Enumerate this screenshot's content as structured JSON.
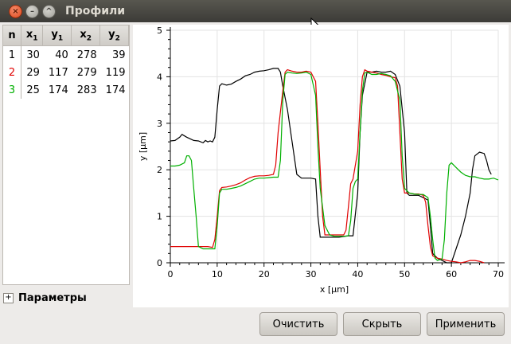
{
  "window": {
    "title": "Профили"
  },
  "table": {
    "headers": [
      {
        "main": "n",
        "sub": ""
      },
      {
        "main": "x",
        "sub": "1"
      },
      {
        "main": "y",
        "sub": "1"
      },
      {
        "main": "x",
        "sub": "2"
      },
      {
        "main": "y",
        "sub": "2"
      }
    ],
    "rows": [
      {
        "n": "1",
        "x1": "30",
        "y1": "40",
        "x2": "278",
        "y2": "39",
        "color": "#000000"
      },
      {
        "n": "2",
        "x1": "29",
        "y1": "117",
        "x2": "279",
        "y2": "119",
        "color": "#e00000"
      },
      {
        "n": "3",
        "x1": "25",
        "y1": "174",
        "x2": "283",
        "y2": "174",
        "color": "#00b000"
      }
    ]
  },
  "params": {
    "label": "Параметры",
    "expand_icon": "+"
  },
  "buttons": {
    "clear": "Очистить",
    "hide": "Скрыть",
    "apply": "Применить"
  },
  "chart_data": {
    "type": "line",
    "xlabel": "x [µm]",
    "ylabel": "y [µm]",
    "xlim": [
      0,
      70
    ],
    "ylim": [
      0,
      5
    ],
    "xticks": [
      0,
      10,
      20,
      30,
      40,
      50,
      60,
      70
    ],
    "yticks": [
      0,
      1,
      2,
      3,
      4,
      5
    ],
    "grid": true,
    "series": [
      {
        "color": "#000000",
        "points": [
          [
            0,
            2.62
          ],
          [
            1,
            2.63
          ],
          [
            2,
            2.7
          ],
          [
            2.5,
            2.76
          ],
          [
            3.5,
            2.7
          ],
          [
            5,
            2.63
          ],
          [
            6,
            2.62
          ],
          [
            7,
            2.58
          ],
          [
            7.5,
            2.63
          ],
          [
            8,
            2.6
          ],
          [
            8.5,
            2.62
          ],
          [
            9,
            2.6
          ],
          [
            9.5,
            2.7
          ],
          [
            10,
            3.3
          ],
          [
            10.5,
            3.8
          ],
          [
            11,
            3.85
          ],
          [
            12,
            3.82
          ],
          [
            13,
            3.84
          ],
          [
            14,
            3.9
          ],
          [
            15,
            3.95
          ],
          [
            16,
            4.02
          ],
          [
            17,
            4.05
          ],
          [
            18,
            4.1
          ],
          [
            19,
            4.12
          ],
          [
            20,
            4.13
          ],
          [
            21,
            4.15
          ],
          [
            22,
            4.18
          ],
          [
            23,
            4.18
          ],
          [
            23.5,
            4.1
          ],
          [
            24,
            3.8
          ],
          [
            25,
            3.3
          ],
          [
            26,
            2.6
          ],
          [
            27,
            1.9
          ],
          [
            28,
            1.82
          ],
          [
            29,
            1.82
          ],
          [
            30,
            1.82
          ],
          [
            31,
            1.8
          ],
          [
            31.5,
            1.0
          ],
          [
            32,
            0.55
          ],
          [
            33,
            0.55
          ],
          [
            34,
            0.55
          ],
          [
            36,
            0.55
          ],
          [
            38,
            0.58
          ],
          [
            39,
            0.58
          ],
          [
            40,
            1.5
          ],
          [
            40.5,
            2.8
          ],
          [
            41,
            3.6
          ],
          [
            42,
            4.1
          ],
          [
            43,
            4.1
          ],
          [
            44,
            4.12
          ],
          [
            45,
            4.1
          ],
          [
            46,
            4.1
          ],
          [
            47,
            4.12
          ],
          [
            48,
            4.05
          ],
          [
            49,
            3.8
          ],
          [
            50,
            2.8
          ],
          [
            50.5,
            1.5
          ],
          [
            51,
            1.45
          ],
          [
            52,
            1.45
          ],
          [
            53,
            1.45
          ],
          [
            54,
            1.4
          ],
          [
            55,
            1.35
          ],
          [
            55.5,
            0.8
          ],
          [
            56,
            0.2
          ],
          [
            57,
            0.1
          ],
          [
            58,
            0.05
          ],
          [
            59,
            0.0
          ],
          [
            60,
            0.0
          ],
          [
            61,
            0.3
          ],
          [
            62,
            0.6
          ],
          [
            63,
            1.0
          ],
          [
            64,
            1.5
          ],
          [
            64.5,
            2.0
          ],
          [
            65,
            2.3
          ],
          [
            66,
            2.38
          ],
          [
            67,
            2.35
          ],
          [
            67.5,
            2.2
          ],
          [
            68,
            2.0
          ],
          [
            68.5,
            1.9
          ]
        ]
      },
      {
        "color": "#e00000",
        "points": [
          [
            0,
            0.35
          ],
          [
            2,
            0.35
          ],
          [
            4,
            0.35
          ],
          [
            6,
            0.35
          ],
          [
            8,
            0.35
          ],
          [
            9,
            0.33
          ],
          [
            9.5,
            0.5
          ],
          [
            10,
            1.0
          ],
          [
            10.5,
            1.55
          ],
          [
            11,
            1.62
          ],
          [
            12,
            1.63
          ],
          [
            13,
            1.65
          ],
          [
            14,
            1.68
          ],
          [
            15,
            1.72
          ],
          [
            16,
            1.78
          ],
          [
            17,
            1.83
          ],
          [
            18,
            1.86
          ],
          [
            19,
            1.87
          ],
          [
            20,
            1.87
          ],
          [
            21,
            1.88
          ],
          [
            22,
            1.9
          ],
          [
            22.5,
            2.1
          ],
          [
            23,
            2.8
          ],
          [
            24,
            3.7
          ],
          [
            24.5,
            4.1
          ],
          [
            25,
            4.15
          ],
          [
            26,
            4.12
          ],
          [
            27,
            4.1
          ],
          [
            28,
            4.1
          ],
          [
            29,
            4.12
          ],
          [
            30,
            4.1
          ],
          [
            31,
            3.9
          ],
          [
            31.5,
            3.0
          ],
          [
            32,
            2.0
          ],
          [
            32.5,
            1.0
          ],
          [
            33,
            0.6
          ],
          [
            34,
            0.6
          ],
          [
            35,
            0.6
          ],
          [
            36,
            0.6
          ],
          [
            37,
            0.6
          ],
          [
            37.5,
            0.7
          ],
          [
            38,
            1.2
          ],
          [
            38.5,
            1.7
          ],
          [
            39,
            1.8
          ],
          [
            40,
            2.4
          ],
          [
            40.5,
            3.4
          ],
          [
            41,
            4.0
          ],
          [
            41.5,
            4.15
          ],
          [
            42,
            4.12
          ],
          [
            43,
            4.1
          ],
          [
            44,
            4.08
          ],
          [
            45,
            4.05
          ],
          [
            46,
            4.03
          ],
          [
            47,
            4.0
          ],
          [
            48,
            3.98
          ],
          [
            48.5,
            3.8
          ],
          [
            49,
            2.8
          ],
          [
            49.5,
            1.8
          ],
          [
            50,
            1.5
          ],
          [
            51,
            1.5
          ],
          [
            52,
            1.48
          ],
          [
            53,
            1.48
          ],
          [
            54,
            1.45
          ],
          [
            54.5,
            1.3
          ],
          [
            55,
            0.8
          ],
          [
            55.5,
            0.35
          ],
          [
            56,
            0.15
          ],
          [
            57,
            0.1
          ],
          [
            58,
            0.08
          ],
          [
            59,
            0.05
          ],
          [
            60,
            0.03
          ],
          [
            61,
            0.02
          ],
          [
            62,
            0.0
          ],
          [
            63,
            0.02
          ],
          [
            64,
            0.05
          ],
          [
            65,
            0.05
          ],
          [
            66,
            0.03
          ],
          [
            67,
            0.0
          ]
        ]
      },
      {
        "color": "#00b000",
        "points": [
          [
            0,
            2.08
          ],
          [
            1,
            2.08
          ],
          [
            2,
            2.1
          ],
          [
            3,
            2.15
          ],
          [
            3.5,
            2.3
          ],
          [
            4,
            2.3
          ],
          [
            4.5,
            2.2
          ],
          [
            5,
            1.6
          ],
          [
            5.5,
            1.0
          ],
          [
            6,
            0.35
          ],
          [
            7,
            0.3
          ],
          [
            8,
            0.3
          ],
          [
            9,
            0.3
          ],
          [
            9.5,
            0.3
          ],
          [
            10,
            0.8
          ],
          [
            10.5,
            1.5
          ],
          [
            11,
            1.58
          ],
          [
            12,
            1.58
          ],
          [
            13,
            1.6
          ],
          [
            14,
            1.62
          ],
          [
            15,
            1.65
          ],
          [
            16,
            1.7
          ],
          [
            17,
            1.75
          ],
          [
            18,
            1.8
          ],
          [
            19,
            1.82
          ],
          [
            20,
            1.82
          ],
          [
            21,
            1.83
          ],
          [
            22,
            1.84
          ],
          [
            23,
            1.84
          ],
          [
            23.5,
            2.2
          ],
          [
            24,
            3.5
          ],
          [
            24.5,
            4.05
          ],
          [
            25,
            4.1
          ],
          [
            26,
            4.08
          ],
          [
            27,
            4.07
          ],
          [
            28,
            4.08
          ],
          [
            29,
            4.1
          ],
          [
            30,
            4.05
          ],
          [
            31,
            3.6
          ],
          [
            31.5,
            2.5
          ],
          [
            32,
            1.6
          ],
          [
            33,
            0.8
          ],
          [
            34,
            0.6
          ],
          [
            35,
            0.57
          ],
          [
            36,
            0.57
          ],
          [
            37,
            0.57
          ],
          [
            38,
            0.58
          ],
          [
            38.5,
            0.9
          ],
          [
            39,
            1.6
          ],
          [
            39.5,
            1.75
          ],
          [
            40,
            1.8
          ],
          [
            40.5,
            2.8
          ],
          [
            41,
            3.7
          ],
          [
            41.5,
            4.08
          ],
          [
            42,
            4.1
          ],
          [
            43,
            4.05
          ],
          [
            44,
            4.05
          ],
          [
            45,
            4.07
          ],
          [
            46,
            4.05
          ],
          [
            47,
            4.02
          ],
          [
            48,
            3.9
          ],
          [
            49,
            3.5
          ],
          [
            49.5,
            2.3
          ],
          [
            50,
            1.6
          ],
          [
            51,
            1.5
          ],
          [
            52,
            1.48
          ],
          [
            53,
            1.47
          ],
          [
            54,
            1.47
          ],
          [
            55,
            1.4
          ],
          [
            55.5,
            1.0
          ],
          [
            56,
            0.5
          ],
          [
            56.5,
            0.1
          ],
          [
            57,
            0.05
          ],
          [
            58,
            0.08
          ],
          [
            58.5,
            0.5
          ],
          [
            59,
            1.5
          ],
          [
            59.5,
            2.1
          ],
          [
            60,
            2.15
          ],
          [
            61,
            2.05
          ],
          [
            62,
            1.95
          ],
          [
            63,
            1.88
          ],
          [
            64,
            1.85
          ],
          [
            65,
            1.85
          ],
          [
            66,
            1.82
          ],
          [
            67,
            1.8
          ],
          [
            68,
            1.8
          ],
          [
            69,
            1.82
          ],
          [
            70,
            1.78
          ]
        ]
      }
    ]
  }
}
